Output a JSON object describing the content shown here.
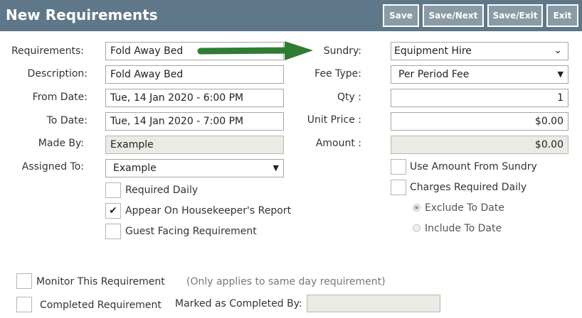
{
  "header": {
    "title": "New Requirements",
    "buttons": {
      "save": "Save",
      "save_next": "Save/Next",
      "save_exit": "Save/Exit",
      "exit": "Exit"
    }
  },
  "left": {
    "requirements": {
      "label": "Requirements:",
      "value": "Fold Away Bed"
    },
    "description": {
      "label": "Description:",
      "value": "Fold Away Bed"
    },
    "from_date": {
      "label": "From Date:",
      "value": "Tue, 14 Jan 2020 - 6:00 PM"
    },
    "to_date": {
      "label": "To Date:",
      "value": "Tue, 14 Jan 2020 - 7:00 PM"
    },
    "made_by": {
      "label": "Made By:",
      "value": "Example"
    },
    "assigned_to": {
      "label": "Assigned To:",
      "value": "Example"
    },
    "required_daily": {
      "label": "Required Daily",
      "checked": false
    },
    "appear_housekeeper": {
      "label": "Appear On Housekeeper's Report",
      "checked": true
    },
    "guest_facing": {
      "label": "Guest Facing Requirement",
      "checked": false
    }
  },
  "right": {
    "sundry": {
      "label": "Sundry:",
      "value": "Equipment Hire"
    },
    "fee_type": {
      "label": "Fee Type:",
      "value": "Per Period Fee"
    },
    "qty": {
      "label": "Qty :",
      "value": "1"
    },
    "unit_price": {
      "label": "Unit Price :",
      "value": "$0.00"
    },
    "amount": {
      "label": "Amount :",
      "value": "$0.00"
    },
    "use_amount_sundry": {
      "label": "Use Amount From Sundry",
      "checked": false
    },
    "charges_required_daily": {
      "label": "Charges Required Daily",
      "checked": false
    },
    "exclude_to_date": {
      "label": "Exclude To Date",
      "selected": true
    },
    "include_to_date": {
      "label": "Include To Date",
      "selected": false
    }
  },
  "bottom": {
    "monitor": {
      "label": "Monitor This Requirement",
      "checked": false
    },
    "monitor_note": "(Only applies to same day requirement)",
    "completed": {
      "label": "Completed Requirement",
      "checked": false
    },
    "marked_completed_by": {
      "label": "Marked as Completed By:",
      "value": ""
    }
  },
  "icons": {
    "checkmark": "check-icon",
    "dropdown": "caret-down-icon",
    "chevron": "chevron-down-icon",
    "arrow": "green-arrow-icon"
  },
  "colors": {
    "header_bg": "#5f7889",
    "button_bg": "#8a9ba6",
    "arrow": "#2e7d32",
    "readonly_bg": "#ebebe6"
  }
}
